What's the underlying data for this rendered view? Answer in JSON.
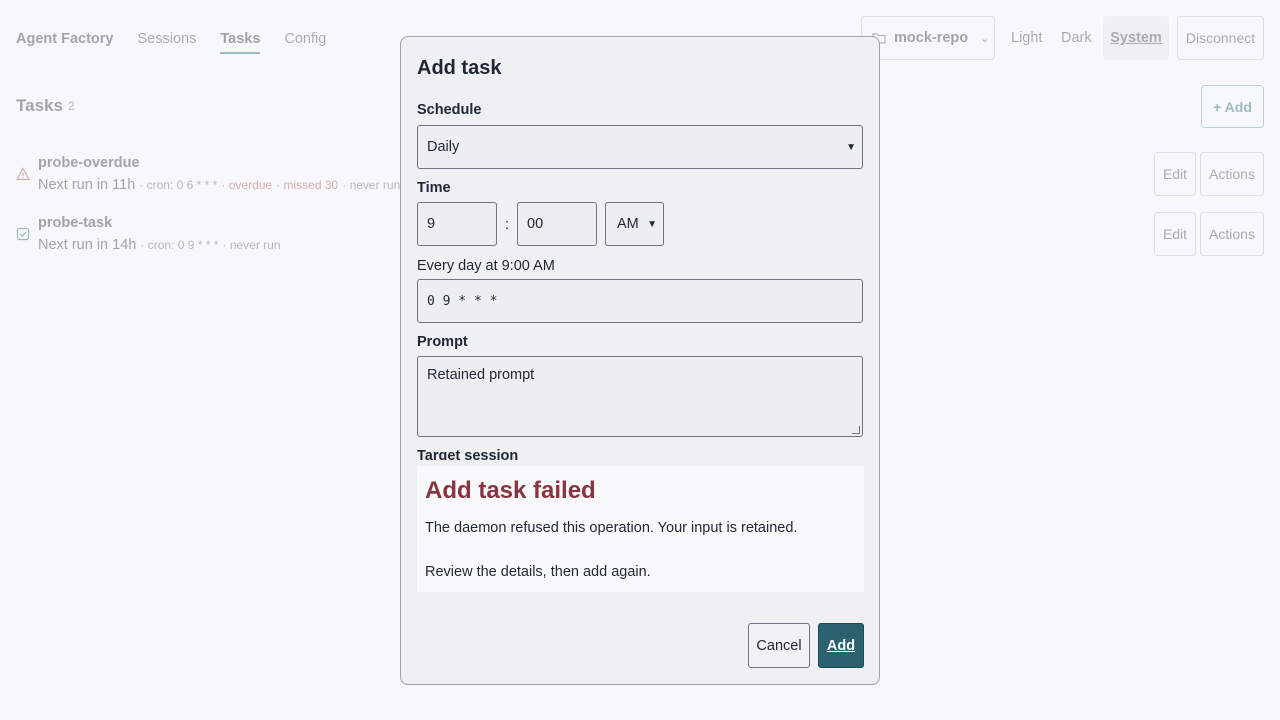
{
  "nav": {
    "brand": "Agent Factory",
    "links": [
      {
        "label": "Sessions",
        "active": false
      },
      {
        "label": "Tasks",
        "active": true
      },
      {
        "label": "Config",
        "active": false
      }
    ]
  },
  "header": {
    "repo": "mock-repo",
    "theme_options": [
      "Light",
      "Dark",
      "System"
    ],
    "theme_selected": "System",
    "disconnect_label": "Disconnect"
  },
  "tasks_section": {
    "title": "Tasks",
    "count": "2",
    "add_label": "+ Add",
    "items": [
      {
        "name": "probe-overdue",
        "next_run": "Next run in 11h",
        "cron": "cron: 0 6 * * *",
        "overdue": "overdue",
        "missed": "missed 30",
        "last": "never run",
        "status_icon": "warning-icon",
        "edit_label": "Edit",
        "actions_label": "Actions"
      },
      {
        "name": "probe-task",
        "next_run": "Next run in 14h",
        "cron": "cron: 0 9 * * *",
        "last": "never run",
        "status_icon": "check-square-icon",
        "edit_label": "Edit",
        "actions_label": "Actions"
      }
    ]
  },
  "modal": {
    "title": "Add task",
    "schedule_label": "Schedule",
    "schedule_value": "Daily",
    "time_label": "Time",
    "hour": "9",
    "separator": ":",
    "minute": "00",
    "ampm": "AM",
    "schedule_summary": "Every day at 9:00 AM",
    "cron_expression": "0 9 * * *",
    "prompt_label": "Prompt",
    "prompt_value": "Retained prompt",
    "target_label": "Target session",
    "error": {
      "title": "Add task failed",
      "message": "The daemon refused this operation. Your input is retained.",
      "hint": "Review the details, then add again."
    },
    "cancel_label": "Cancel",
    "submit_label": "Add"
  },
  "colors": {
    "accent": "#2a6270",
    "error": "#8a3440",
    "warning": "#b0453d"
  }
}
